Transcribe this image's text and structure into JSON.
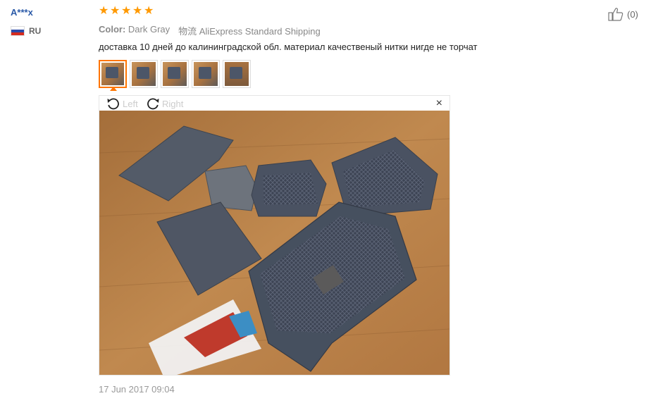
{
  "reviewer": {
    "name": "A***x",
    "country_code": "RU",
    "flag_colors": [
      "#ffffff",
      "#2b4aa9",
      "#d52b1e"
    ]
  },
  "rating": {
    "stars": 5,
    "star_char": "★",
    "color": "#ff9900"
  },
  "like": {
    "count_label": "(0)",
    "icon": "thumbs-up-icon"
  },
  "meta": {
    "color_label": "Color:",
    "color_value": "Dark Gray",
    "shipping_value": "物流 AliExpress Standard Shipping"
  },
  "review_text": "доставка 10 дней до калининградской обл. материал качественый нитки нигде не торчат",
  "thumbnails": {
    "count": 5,
    "selected_index": 0
  },
  "viewer": {
    "rotate_left_label": "Left",
    "rotate_right_label": "Right",
    "close_label": "×"
  },
  "date": "17 Jun 2017 09:04"
}
